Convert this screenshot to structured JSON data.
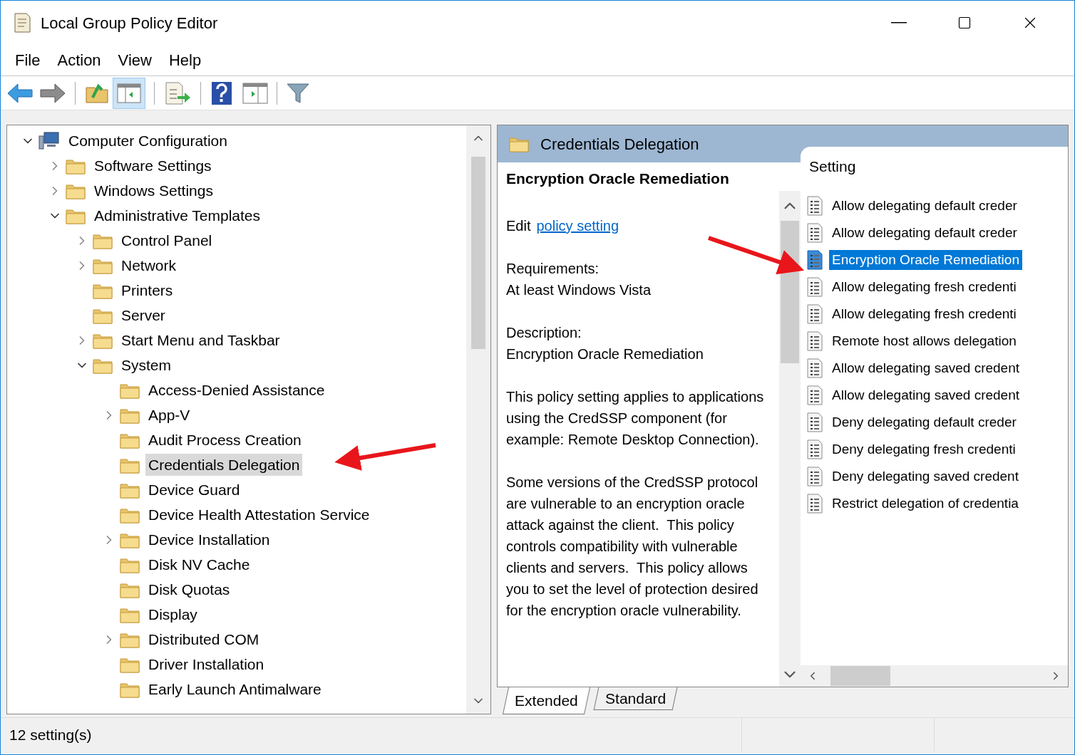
{
  "window": {
    "title": "Local Group Policy Editor"
  },
  "menu": [
    "File",
    "Action",
    "View",
    "Help"
  ],
  "tree": [
    {
      "label": "Computer Configuration",
      "kind": "computer",
      "expanded": true,
      "selected": false,
      "children": [
        {
          "label": "Software Settings",
          "kind": "folder",
          "expanded": false,
          "selected": false
        },
        {
          "label": "Windows Settings",
          "kind": "folder",
          "expanded": false,
          "selected": false
        },
        {
          "label": "Administrative Templates",
          "kind": "folder",
          "expanded": true,
          "selected": false,
          "children": [
            {
              "label": "Control Panel",
              "kind": "folder",
              "expanded": false,
              "selected": false
            },
            {
              "label": "Network",
              "kind": "folder",
              "expanded": false,
              "selected": false
            },
            {
              "label": "Printers",
              "kind": "folder",
              "selected": false
            },
            {
              "label": "Server",
              "kind": "folder",
              "selected": false
            },
            {
              "label": "Start Menu and Taskbar",
              "kind": "folder",
              "expanded": false,
              "selected": false
            },
            {
              "label": "System",
              "kind": "folder",
              "expanded": true,
              "selected": false,
              "children": [
                {
                  "label": "Access-Denied Assistance",
                  "kind": "folder",
                  "selected": false
                },
                {
                  "label": "App-V",
                  "kind": "folder",
                  "expanded": false,
                  "selected": false
                },
                {
                  "label": "Audit Process Creation",
                  "kind": "folder",
                  "selected": false
                },
                {
                  "label": "Credentials Delegation",
                  "kind": "folder",
                  "selected": true
                },
                {
                  "label": "Device Guard",
                  "kind": "folder",
                  "selected": false
                },
                {
                  "label": "Device Health Attestation Service",
                  "kind": "folder",
                  "selected": false
                },
                {
                  "label": "Device Installation",
                  "kind": "folder",
                  "expanded": false,
                  "selected": false
                },
                {
                  "label": "Disk NV Cache",
                  "kind": "folder",
                  "selected": false
                },
                {
                  "label": "Disk Quotas",
                  "kind": "folder",
                  "selected": false
                },
                {
                  "label": "Display",
                  "kind": "folder",
                  "selected": false
                },
                {
                  "label": "Distributed COM",
                  "kind": "folder",
                  "expanded": false,
                  "selected": false
                },
                {
                  "label": "Driver Installation",
                  "kind": "folder",
                  "selected": false
                },
                {
                  "label": "Early Launch Antimalware",
                  "kind": "folder",
                  "selected": false
                }
              ]
            }
          ]
        }
      ]
    }
  ],
  "details": {
    "header": "Credentials Delegation",
    "title": "Encryption Oracle Remediation",
    "edit_prefix": "Edit",
    "edit_link": "policy setting",
    "paragraphs": [
      [
        "Requirements:",
        "At least Windows Vista"
      ],
      [
        "Description:",
        "Encryption Oracle Remediation"
      ],
      [
        "This policy setting applies to applications using the CredSSP component (for example: Remote Desktop Connection)."
      ],
      [
        "Some versions of the CredSSP protocol are vulnerable to an encryption oracle attack against the client.  This policy controls compatibility with vulnerable clients and servers.  This policy allows you to set the level of protection desired for the encryption oracle vulnerability."
      ]
    ]
  },
  "list": {
    "column": "Setting",
    "rows": [
      {
        "label": "Allow delegating default creder",
        "selected": false
      },
      {
        "label": "Allow delegating default creder",
        "selected": false
      },
      {
        "label": "Encryption Oracle Remediation",
        "selected": true
      },
      {
        "label": "Allow delegating fresh credenti",
        "selected": false
      },
      {
        "label": "Allow delegating fresh credenti",
        "selected": false
      },
      {
        "label": "Remote host allows delegation",
        "selected": false
      },
      {
        "label": "Allow delegating saved credent",
        "selected": false
      },
      {
        "label": "Allow delegating saved credent",
        "selected": false
      },
      {
        "label": "Deny delegating default creder",
        "selected": false
      },
      {
        "label": "Deny delegating fresh credenti",
        "selected": false
      },
      {
        "label": "Deny delegating saved credent",
        "selected": false
      },
      {
        "label": "Restrict delegation of credentia",
        "selected": false
      }
    ]
  },
  "tabs": [
    {
      "label": "Extended",
      "selected": true
    },
    {
      "label": "Standard",
      "selected": false
    }
  ],
  "status_bar": "12 setting(s)"
}
